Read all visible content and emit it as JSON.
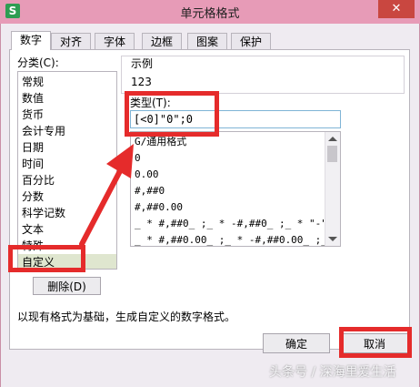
{
  "window": {
    "title": "单元格格式",
    "close": "✕",
    "app_icon": "S"
  },
  "tabs": [
    "数字",
    "对齐",
    "字体",
    "边框",
    "图案",
    "保护"
  ],
  "category": {
    "label": "分类(C):",
    "items": [
      "常规",
      "数值",
      "货币",
      "会计专用",
      "日期",
      "时间",
      "百分比",
      "分数",
      "科学记数",
      "文本",
      "特殊",
      "自定义"
    ],
    "selected": "自定义"
  },
  "sample": {
    "label": "示例",
    "value": "123"
  },
  "type": {
    "label": "类型(T):",
    "value": "[<0]\"0\";0"
  },
  "formats": [
    "G/通用格式",
    "0",
    "0.00",
    "#,##0",
    "#,##0.00",
    "_ * #,##0_ ;_ * -#,##0_ ;_ * \"-\"…",
    "_ * #,##0.00_ ;_ * -#,##0.00_ ;_…"
  ],
  "delete_button": "删除(D)",
  "description": "以现有格式为基础，生成自定义的数字格式。",
  "buttons": {
    "ok": "确定",
    "cancel": "取消"
  },
  "watermark": "头条号 / 深海里爱生活",
  "colors": {
    "titlebar": "#e79bb7",
    "annotation": "#e52b2b",
    "selected": "#dfe6cf"
  }
}
